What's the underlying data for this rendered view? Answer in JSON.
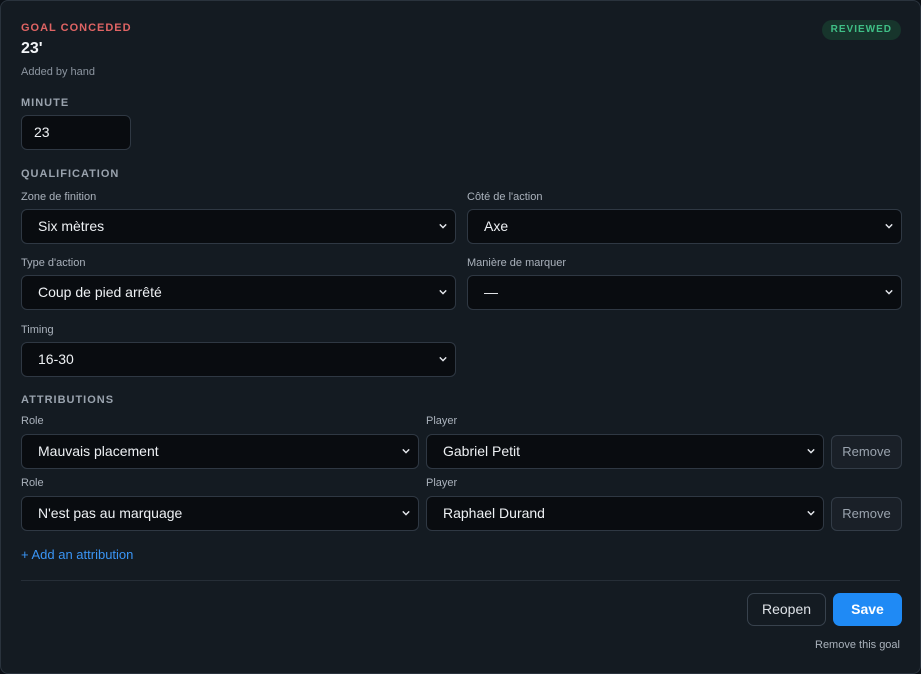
{
  "header": {
    "kicker": "GOAL CONCEDED",
    "title": "23'",
    "subtitle": "Added by hand",
    "badge": "REVIEWED",
    "badge_color": "#3fbf86",
    "kicker_color": "#e06464"
  },
  "minute": {
    "section_label": "MINUTE",
    "value": "23"
  },
  "qualification": {
    "section_label": "QUALIFICATION",
    "zone": {
      "label": "Zone de finition",
      "value": "Six mètres"
    },
    "cote": {
      "label": "Côté de l'action",
      "value": "Axe"
    },
    "type": {
      "label": "Type d'action",
      "value": "Coup de pied arrêté"
    },
    "maniere": {
      "label": "Manière de marquer",
      "value": "—"
    },
    "timing": {
      "label": "Timing",
      "value": "16-30"
    }
  },
  "attributions": {
    "section_label": "ATTRIBUTIONS",
    "rows": [
      {
        "role_label": "Role",
        "role_value": "Mauvais placement",
        "player_label": "Player",
        "player_value": "Gabriel Petit",
        "remove_label": "Remove"
      },
      {
        "role_label": "Role",
        "role_value": "N'est pas au marquage",
        "player_label": "Player",
        "player_value": "Raphael Durand",
        "remove_label": "Remove"
      }
    ],
    "add_label": "+ Add an attribution"
  },
  "footer": {
    "reopen_label": "Reopen",
    "save_label": "Save",
    "save_color": "#1f8af5",
    "remove_goal_label": "Remove this goal"
  },
  "icons": {
    "select": "chevron-down-icon"
  }
}
